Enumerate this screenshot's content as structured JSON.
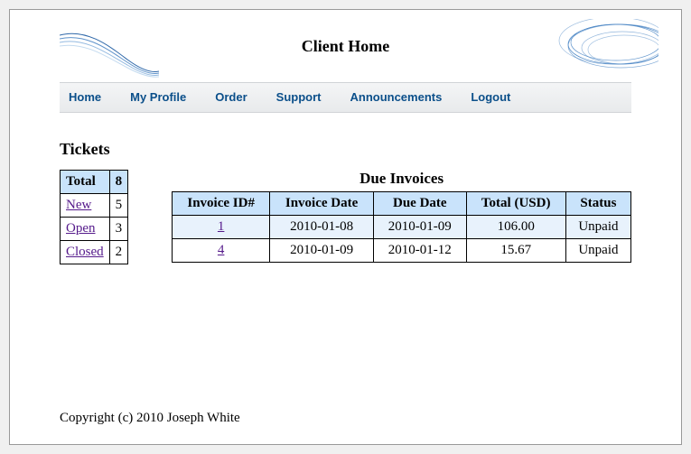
{
  "header": {
    "title": "Client Home"
  },
  "nav": {
    "items": [
      {
        "label": "Home"
      },
      {
        "label": "My Profile"
      },
      {
        "label": "Order"
      },
      {
        "label": "Support"
      },
      {
        "label": "Announcements"
      },
      {
        "label": "Logout"
      }
    ]
  },
  "tickets": {
    "heading": "Tickets",
    "total_label": "Total",
    "total_value": "8",
    "rows": [
      {
        "label": "New",
        "count": "5"
      },
      {
        "label": "Open",
        "count": "3"
      },
      {
        "label": "Closed",
        "count": "2"
      }
    ]
  },
  "invoices": {
    "heading": "Due Invoices",
    "columns": [
      "Invoice ID#",
      "Invoice Date",
      "Due Date",
      "Total (USD)",
      "Status"
    ],
    "rows": [
      {
        "id": "1",
        "date": "2010-01-08",
        "due": "2010-01-09",
        "total": "106.00",
        "status": "Unpaid"
      },
      {
        "id": "4",
        "date": "2010-01-09",
        "due": "2010-01-12",
        "total": "15.67",
        "status": "Unpaid"
      }
    ]
  },
  "footer": {
    "text": "Copyright (c) 2010 Joseph White"
  }
}
